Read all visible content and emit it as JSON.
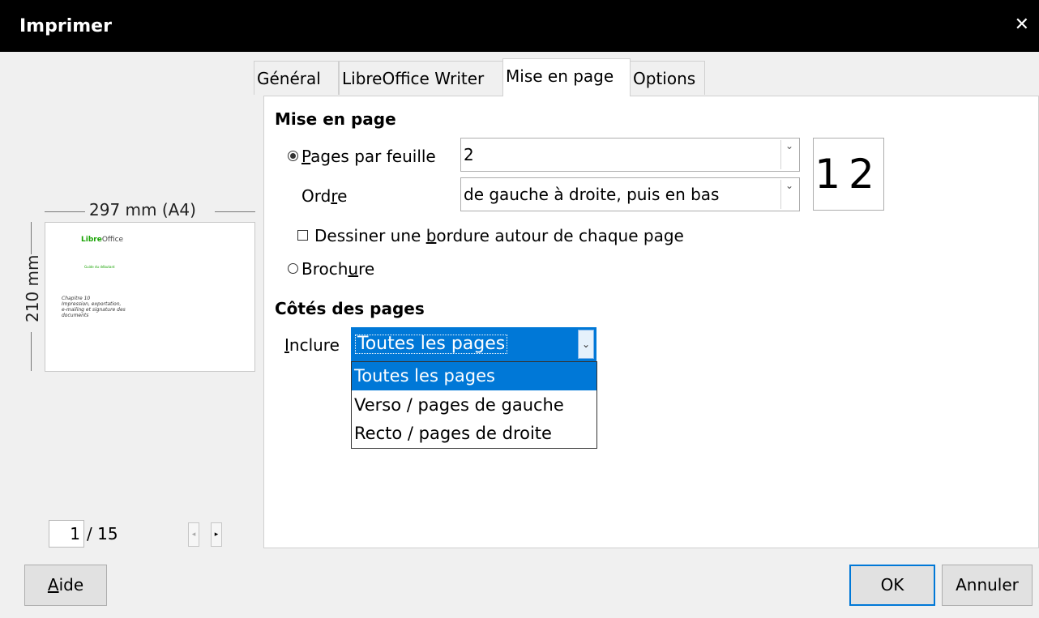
{
  "window": {
    "title": "Imprimer",
    "close_glyph": "✕"
  },
  "preview": {
    "width_label": "297 mm (A4)",
    "height_label": "210 mm",
    "page_logo_brand": "Libre",
    "page_logo_rest": "Office",
    "page_subtitle": "Guide du débutant",
    "page_title_lines": "Chapitre 10\nImpression, exportation,\ne-mailing et signature des\ndocuments",
    "current_page": "1",
    "page_count": "/ 15",
    "prev_icon": "◂",
    "next_icon": "▸"
  },
  "tabs": [
    {
      "label": "Général"
    },
    {
      "label": "LibreOffice Writer"
    },
    {
      "label": "Mise en page",
      "active": true
    },
    {
      "label": "Options"
    }
  ],
  "layout": {
    "section_heading": "Mise en page",
    "pages_per_sheet": {
      "label_pre": "",
      "mnemonic": "P",
      "label_post": "ages par feuille",
      "value": "2",
      "selected": true
    },
    "order": {
      "label_pre": "Ord",
      "mnemonic": "r",
      "label_post": "e",
      "value": "de gauche à droite, puis en bas"
    },
    "order_preview": "12",
    "border": {
      "label_pre": "Dessiner une ",
      "mnemonic": "b",
      "label_post": "ordure autour de chaque page",
      "checked": false
    },
    "brochure": {
      "label_pre": "Broch",
      "mnemonic": "u",
      "label_post": "re",
      "selected": false
    }
  },
  "sides": {
    "section_heading": "Côtés des pages",
    "include_label_mnemonic": "I",
    "include_label_rest": "nclure",
    "include_value": "Toutes les pages",
    "options": [
      "Toutes les pages",
      "Verso / pages de gauche",
      "Recto / pages de droite"
    ],
    "selected_index": 0
  },
  "buttons": {
    "help_mnemonic": "A",
    "help_rest": "ide",
    "ok": "OK",
    "cancel": "Annuler"
  },
  "icons": {
    "combo_arrow": "chevron-down-icon",
    "arrow_glyph": "⌄"
  },
  "colors": {
    "accent": "#0078d7",
    "brand_green": "#18a303",
    "titlebar": "#000000"
  }
}
